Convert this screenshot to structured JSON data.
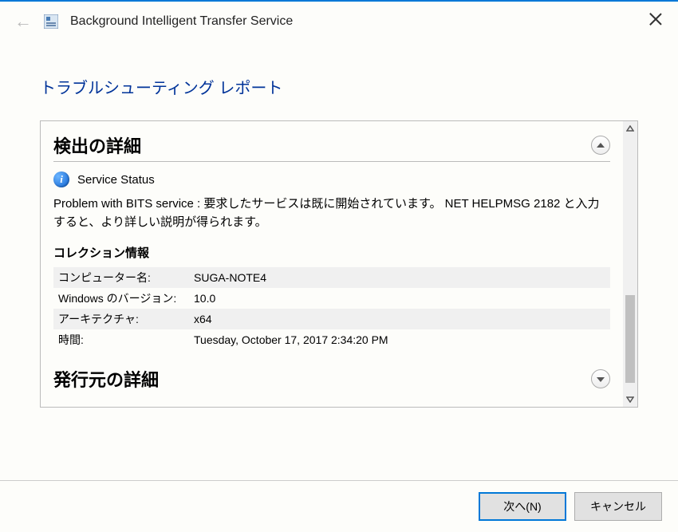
{
  "header": {
    "title": "Background Intelligent Transfer Service"
  },
  "report_heading": "トラブルシューティング レポート",
  "detection": {
    "title": "検出の詳細",
    "status_label": "Service Status",
    "problem_text": "Problem with BITS service : 要求したサービスは既に開始されています。 NET HELPMSG 2182 と入力すると、より詳しい説明が得られます。",
    "collection_heading": "コレクション情報",
    "rows": [
      {
        "label": "コンピューター名:",
        "value": "SUGA-NOTE4"
      },
      {
        "label": "Windows のバージョン:",
        "value": "10.0"
      },
      {
        "label": "アーキテクチャ:",
        "value": "x64"
      },
      {
        "label": "時間:",
        "value": "Tuesday, October 17, 2017 2:34:20 PM"
      }
    ]
  },
  "publisher": {
    "title": "発行元の詳細"
  },
  "footer": {
    "next": "次へ(N)",
    "cancel": "キャンセル"
  }
}
